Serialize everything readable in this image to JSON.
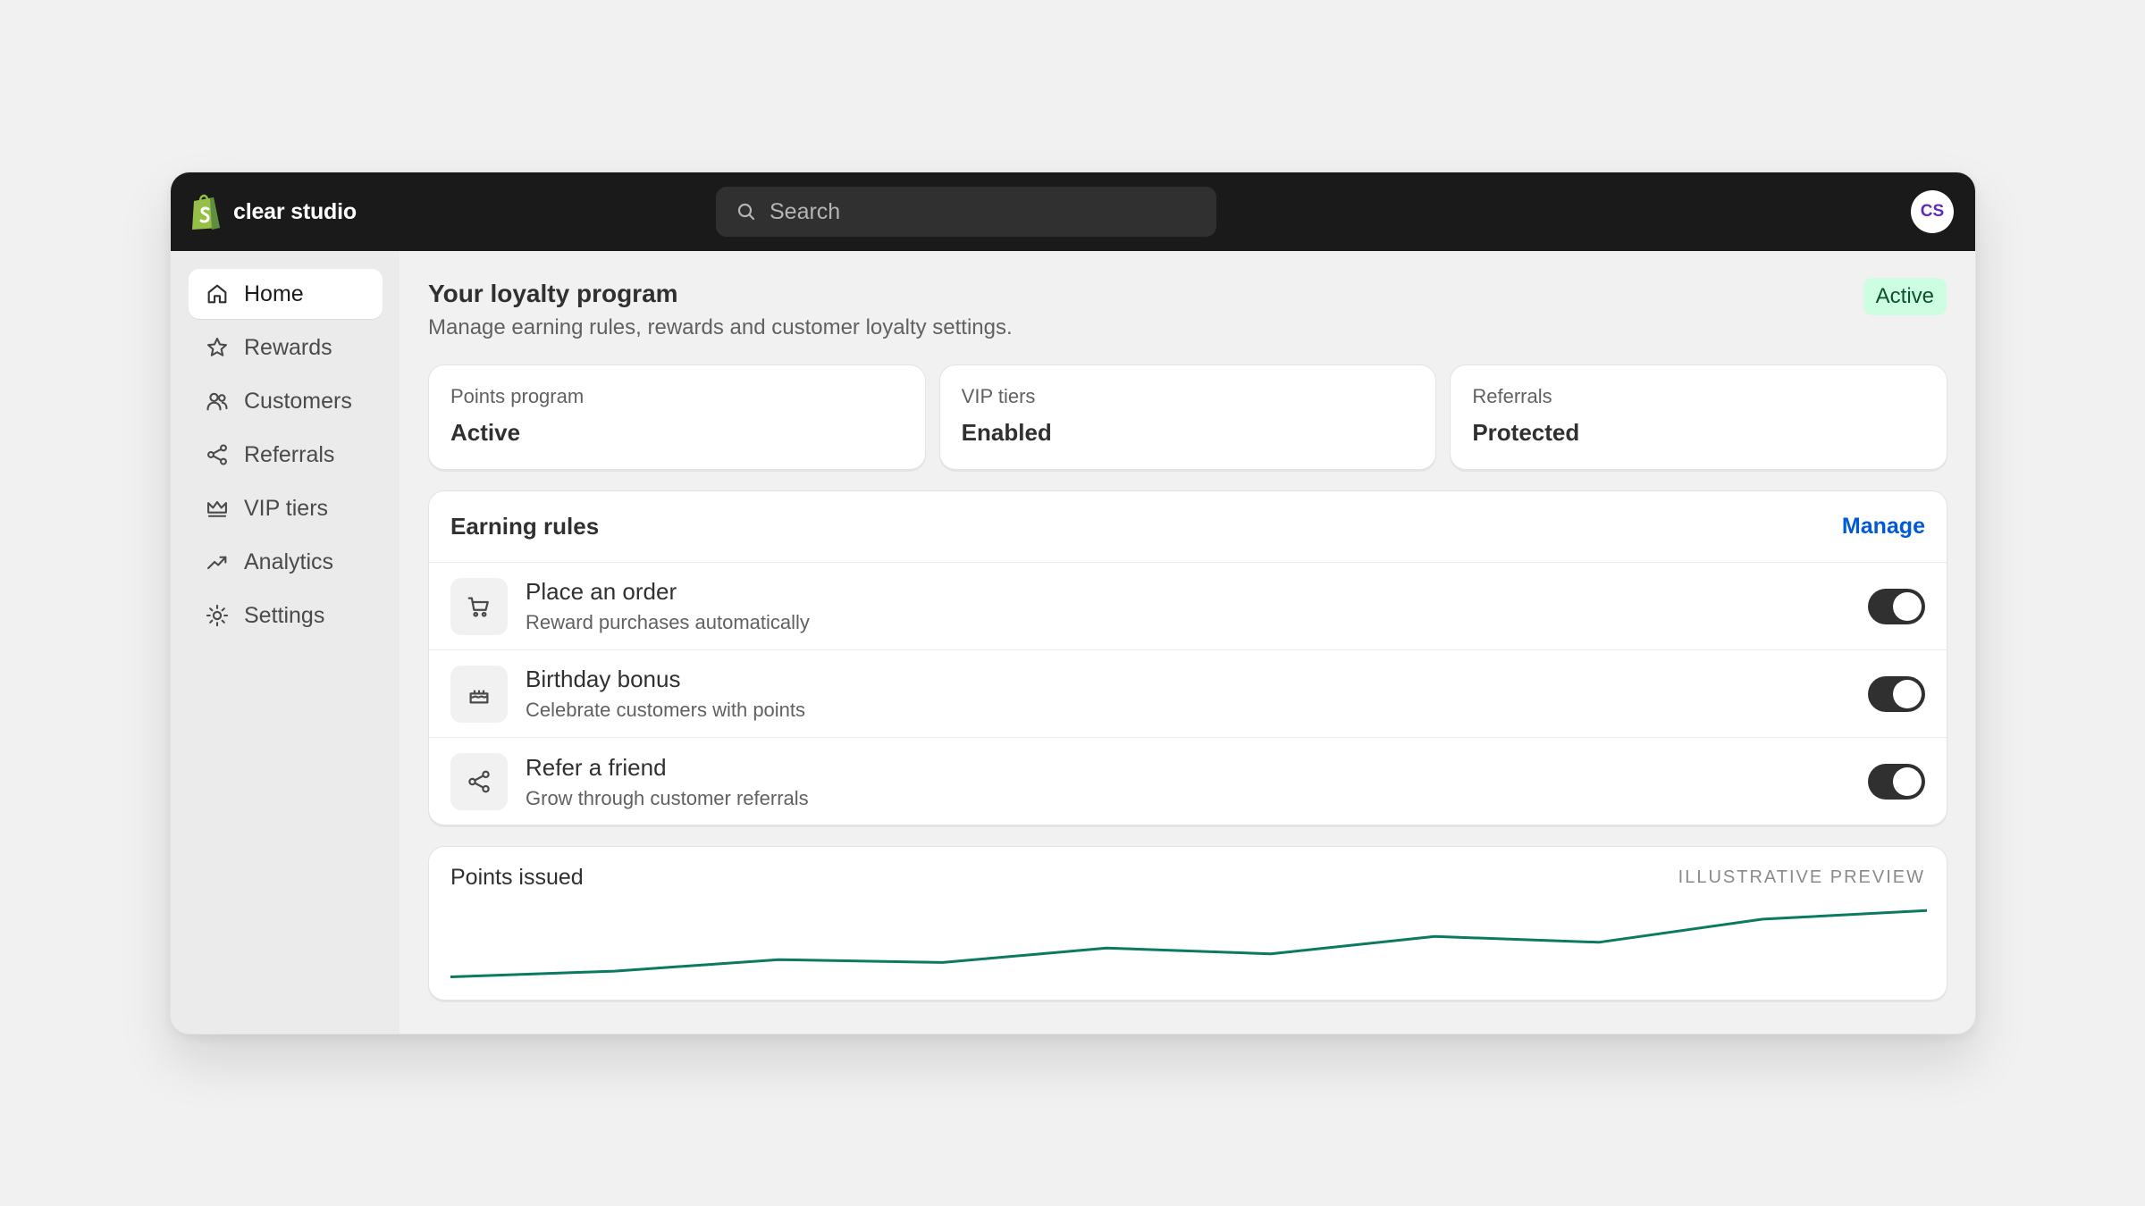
{
  "brand": {
    "name": "clear studio"
  },
  "search": {
    "placeholder": "Search"
  },
  "user": {
    "initials": "CS"
  },
  "sidebar": {
    "items": [
      {
        "label": "Home",
        "icon": "home-icon",
        "active": true
      },
      {
        "label": "Rewards",
        "icon": "star-icon"
      },
      {
        "label": "Customers",
        "icon": "people-icon"
      },
      {
        "label": "Referrals",
        "icon": "share-icon"
      },
      {
        "label": "VIP tiers",
        "icon": "crown-icon"
      },
      {
        "label": "Analytics",
        "icon": "trend-up-icon"
      },
      {
        "label": "Settings",
        "icon": "gear-icon"
      }
    ]
  },
  "page": {
    "title": "Your loyalty program",
    "subtitle": "Manage earning rules, rewards and customer loyalty settings.",
    "status": "Active"
  },
  "cards": [
    {
      "label": "Points program",
      "value": "Active"
    },
    {
      "label": "VIP tiers",
      "value": "Enabled"
    },
    {
      "label": "Referrals",
      "value": "Protected"
    }
  ],
  "earning_rules": {
    "title": "Earning rules",
    "manage_label": "Manage",
    "rules": [
      {
        "title": "Place an order",
        "description": "Reward purchases automatically",
        "icon": "cart-icon",
        "enabled": true
      },
      {
        "title": "Birthday bonus",
        "description": "Celebrate customers with points",
        "icon": "cake-icon",
        "enabled": true
      },
      {
        "title": "Refer a friend",
        "description": "Grow through customer referrals",
        "icon": "share-icon",
        "enabled": true
      }
    ]
  },
  "points_chart": {
    "title": "Points issued",
    "tag": "ILLUSTRATIVE PREVIEW"
  },
  "colors": {
    "topbar": "#1a1a1a",
    "accent_link": "#005bd3",
    "badge_bg": "#cdfee1",
    "badge_text": "#0c5132",
    "chart_line": "#0b7a5e"
  },
  "chart_data": {
    "type": "line",
    "title": "Points issued",
    "x": [
      0,
      1,
      2,
      3,
      4,
      5,
      6,
      7,
      8,
      9
    ],
    "series": [
      {
        "values": [
          1,
          2,
          4,
          3.5,
          6,
          5,
          8,
          7,
          11,
          12.5
        ]
      }
    ],
    "ylim": [
      0,
      13
    ],
    "axes_visible": false,
    "grid": false
  }
}
